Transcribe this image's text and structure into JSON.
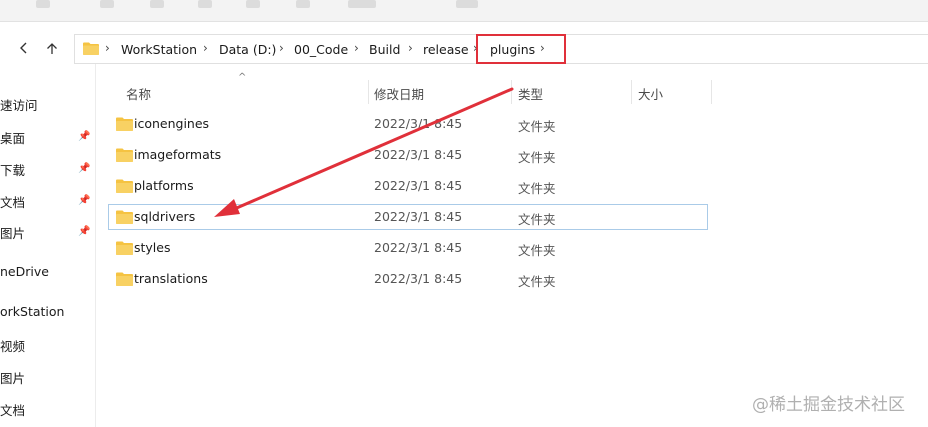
{
  "address": {
    "crumbs": [
      "WorkStation",
      "Data (D:)",
      "00_Code",
      "Build",
      "release",
      "plugins"
    ],
    "chevron": "›"
  },
  "nav": {
    "back_icon": "chevron-left-icon",
    "up_icon": "arrow-up-icon"
  },
  "sidebar": {
    "items": [
      {
        "label": "速访问",
        "pinned": false
      },
      {
        "label": "桌面",
        "pinned": true
      },
      {
        "label": "下载",
        "pinned": true
      },
      {
        "label": "文档",
        "pinned": true
      },
      {
        "label": "图片",
        "pinned": true
      },
      {
        "label": "neDrive",
        "pinned": false
      },
      {
        "label": "orkStation",
        "pinned": false
      },
      {
        "label": "视频",
        "pinned": false
      },
      {
        "label": "图片",
        "pinned": false
      },
      {
        "label": "文档",
        "pinned": false
      }
    ]
  },
  "columns": {
    "name": "名称",
    "date": "修改日期",
    "type": "类型",
    "size": "大小"
  },
  "files": [
    {
      "name": "iconengines",
      "date": "2022/3/1 8:45",
      "type": "文件夹"
    },
    {
      "name": "imageformats",
      "date": "2022/3/1 8:45",
      "type": "文件夹"
    },
    {
      "name": "platforms",
      "date": "2022/3/1 8:45",
      "type": "文件夹"
    },
    {
      "name": "sqldrivers",
      "date": "2022/3/1 8:45",
      "type": "文件夹",
      "selected": true
    },
    {
      "name": "styles",
      "date": "2022/3/1 8:45",
      "type": "文件夹"
    },
    {
      "name": "translations",
      "date": "2022/3/1 8:45",
      "type": "文件夹"
    }
  ],
  "colors": {
    "annotation_red": "#e0303a",
    "folder_yellow": "#f5c342",
    "selection_border": "#aacbe8"
  },
  "watermark": "@稀土掘金技术社区"
}
